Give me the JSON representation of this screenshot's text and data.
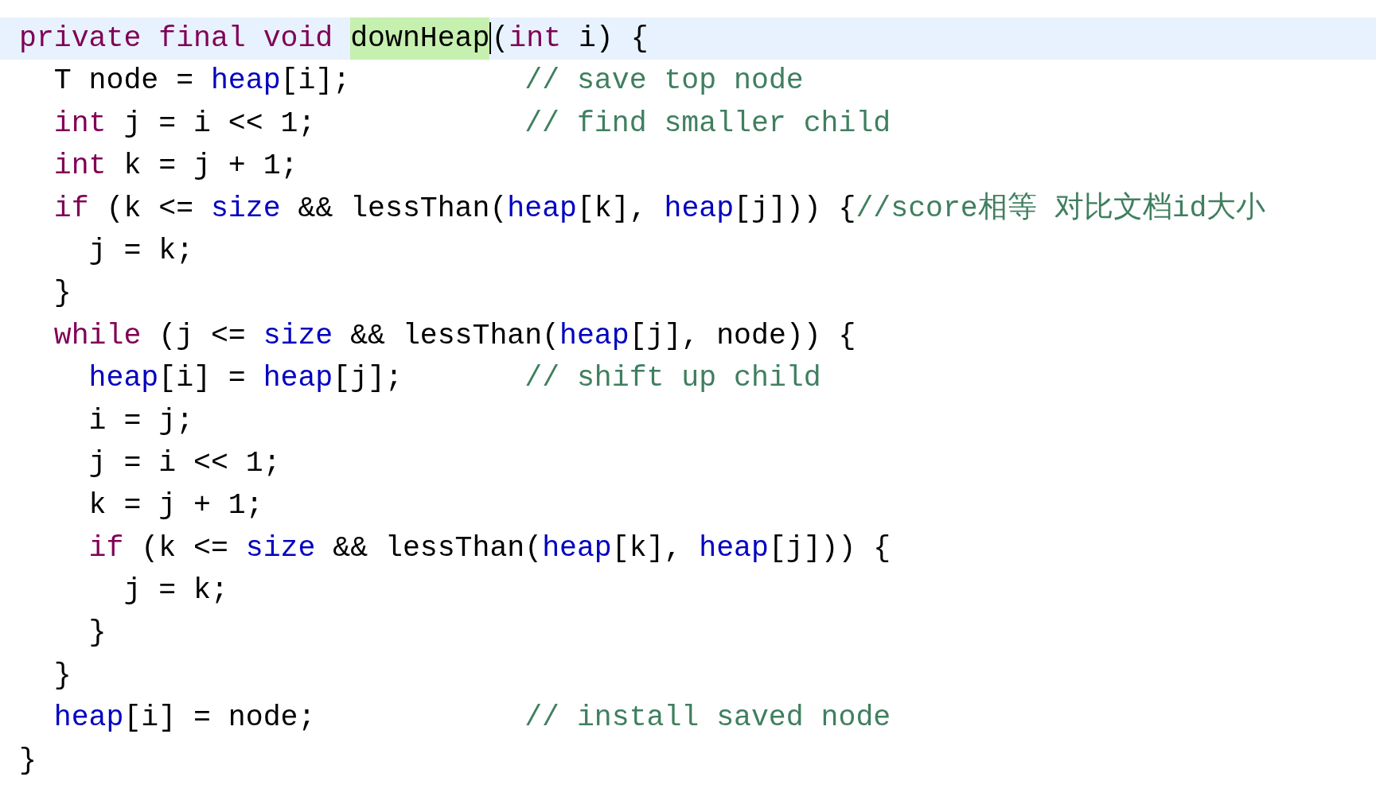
{
  "editor": {
    "lines": [
      {
        "current": true,
        "tokens": [
          {
            "kind": "keyword",
            "text": "private "
          },
          {
            "kind": "keyword",
            "text": "final "
          },
          {
            "kind": "keyword",
            "text": "void "
          },
          {
            "kind": "occurrence",
            "text": "downHeap"
          },
          {
            "kind": "caret"
          },
          {
            "kind": "plain",
            "text": "("
          },
          {
            "kind": "keyword",
            "text": "int"
          },
          {
            "kind": "plain",
            "text": " i) {"
          }
        ]
      },
      {
        "current": false,
        "tokens": [
          {
            "kind": "plain",
            "text": "  T node = "
          },
          {
            "kind": "field",
            "text": "heap"
          },
          {
            "kind": "plain",
            "text": "[i];          "
          },
          {
            "kind": "comment",
            "text": "// save top node"
          }
        ]
      },
      {
        "current": false,
        "tokens": [
          {
            "kind": "keyword",
            "text": "  int"
          },
          {
            "kind": "plain",
            "text": " j = i << 1;            "
          },
          {
            "kind": "comment",
            "text": "// find smaller child"
          }
        ]
      },
      {
        "current": false,
        "tokens": [
          {
            "kind": "keyword",
            "text": "  int"
          },
          {
            "kind": "plain",
            "text": " k = j + 1;"
          }
        ]
      },
      {
        "current": false,
        "tokens": [
          {
            "kind": "keyword",
            "text": "  if"
          },
          {
            "kind": "plain",
            "text": " (k <= "
          },
          {
            "kind": "field",
            "text": "size"
          },
          {
            "kind": "plain",
            "text": " && lessThan("
          },
          {
            "kind": "field",
            "text": "heap"
          },
          {
            "kind": "plain",
            "text": "[k], "
          },
          {
            "kind": "field",
            "text": "heap"
          },
          {
            "kind": "plain",
            "text": "[j])) {"
          },
          {
            "kind": "comment",
            "text": "//score相等 对比文档id大小"
          }
        ]
      },
      {
        "current": false,
        "tokens": [
          {
            "kind": "plain",
            "text": "    j = k;"
          }
        ]
      },
      {
        "current": false,
        "tokens": [
          {
            "kind": "plain",
            "text": "  }"
          }
        ]
      },
      {
        "current": false,
        "tokens": [
          {
            "kind": "keyword",
            "text": "  while"
          },
          {
            "kind": "plain",
            "text": " (j <= "
          },
          {
            "kind": "field",
            "text": "size"
          },
          {
            "kind": "plain",
            "text": " && lessThan("
          },
          {
            "kind": "field",
            "text": "heap"
          },
          {
            "kind": "plain",
            "text": "[j], node)) {"
          }
        ]
      },
      {
        "current": false,
        "tokens": [
          {
            "kind": "field",
            "text": "    heap"
          },
          {
            "kind": "plain",
            "text": "[i] = "
          },
          {
            "kind": "field",
            "text": "heap"
          },
          {
            "kind": "plain",
            "text": "[j];       "
          },
          {
            "kind": "comment",
            "text": "// shift up child"
          }
        ]
      },
      {
        "current": false,
        "tokens": [
          {
            "kind": "plain",
            "text": "    i = j;"
          }
        ]
      },
      {
        "current": false,
        "tokens": [
          {
            "kind": "plain",
            "text": "    j = i << 1;"
          }
        ]
      },
      {
        "current": false,
        "tokens": [
          {
            "kind": "plain",
            "text": "    k = j + 1;"
          }
        ]
      },
      {
        "current": false,
        "tokens": [
          {
            "kind": "keyword",
            "text": "    if"
          },
          {
            "kind": "plain",
            "text": " (k <= "
          },
          {
            "kind": "field",
            "text": "size"
          },
          {
            "kind": "plain",
            "text": " && lessThan("
          },
          {
            "kind": "field",
            "text": "heap"
          },
          {
            "kind": "plain",
            "text": "[k], "
          },
          {
            "kind": "field",
            "text": "heap"
          },
          {
            "kind": "plain",
            "text": "[j])) {"
          }
        ]
      },
      {
        "current": false,
        "tokens": [
          {
            "kind": "plain",
            "text": "      j = k;"
          }
        ]
      },
      {
        "current": false,
        "tokens": [
          {
            "kind": "plain",
            "text": "    }"
          }
        ]
      },
      {
        "current": false,
        "tokens": [
          {
            "kind": "plain",
            "text": "  }"
          }
        ]
      },
      {
        "current": false,
        "tokens": [
          {
            "kind": "field",
            "text": "  heap"
          },
          {
            "kind": "plain",
            "text": "[i] = node;            "
          },
          {
            "kind": "comment",
            "text": "// install saved node"
          }
        ]
      },
      {
        "current": false,
        "tokens": [
          {
            "kind": "plain",
            "text": "}"
          }
        ]
      }
    ]
  }
}
